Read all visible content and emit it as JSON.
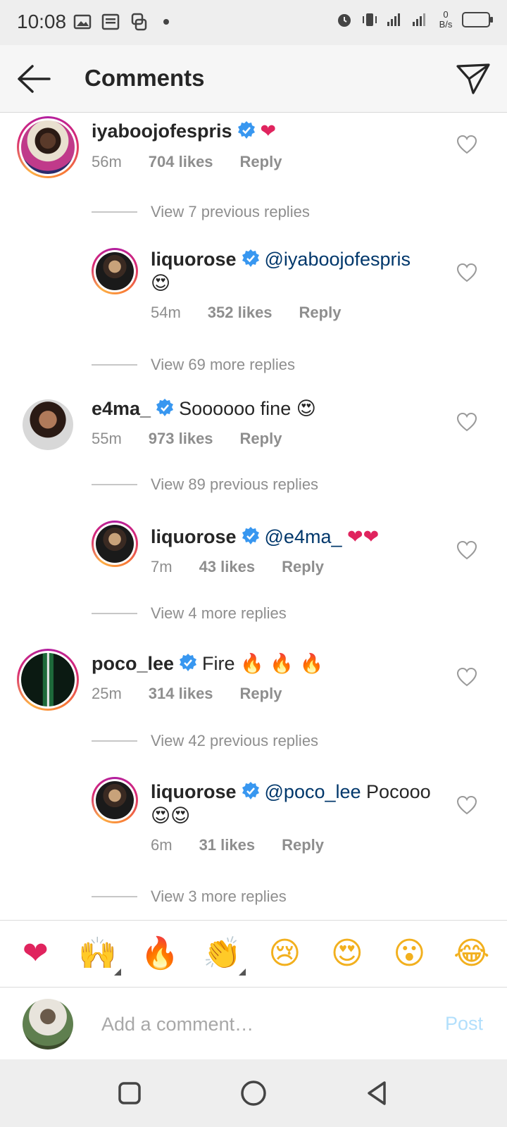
{
  "status_bar": {
    "time": "10:08",
    "net_speed_top": "0",
    "net_speed_bottom": "B/s"
  },
  "header": {
    "title": "Comments"
  },
  "comments": [
    {
      "username": "iyaboojofespris",
      "verified": true,
      "text": "",
      "emoji": "❤",
      "time": "56m",
      "likes": "704 likes",
      "reply_label": "Reply",
      "view_replies_label": "View 7 previous replies",
      "reply": {
        "username": "liquorose",
        "mention": "@iyaboojofespris",
        "text": "",
        "emoji": "😍",
        "time": "54m",
        "likes": "352 likes",
        "reply_label": "Reply",
        "view_more_label": "View 69 more replies"
      }
    },
    {
      "username": "e4ma_",
      "verified": true,
      "text": "Soooooo fine",
      "emoji": "😍",
      "time": "55m",
      "likes": "973 likes",
      "reply_label": "Reply",
      "view_replies_label": "View 89 previous replies",
      "reply": {
        "username": "liquorose",
        "mention": "@e4ma_",
        "text": "",
        "emoji": "❤❤",
        "time": "7m",
        "likes": "43 likes",
        "reply_label": "Reply",
        "view_more_label": "View 4 more replies"
      }
    },
    {
      "username": "poco_lee",
      "verified": true,
      "text": "Fire",
      "emoji": "🔥 🔥 🔥",
      "time": "25m",
      "likes": "314 likes",
      "reply_label": "Reply",
      "view_replies_label": "View 42 previous replies",
      "reply": {
        "username": "liquorose",
        "mention": "@poco_lee",
        "text": "Pocooo",
        "emoji": "😍😍",
        "time": "6m",
        "likes": "31 likes",
        "reply_label": "Reply",
        "view_more_label": "View 3 more replies"
      }
    }
  ],
  "emoji_bar": [
    "❤",
    "🙌",
    "🔥",
    "👏",
    "😢",
    "😍",
    "😮",
    "😂"
  ],
  "composer": {
    "placeholder": "Add a comment…",
    "post_label": "Post"
  },
  "colors": {
    "accent": "#0095f6",
    "verified": "#3897f0",
    "muted": "#8e8e8e",
    "post_disabled": "#b2dffc"
  }
}
